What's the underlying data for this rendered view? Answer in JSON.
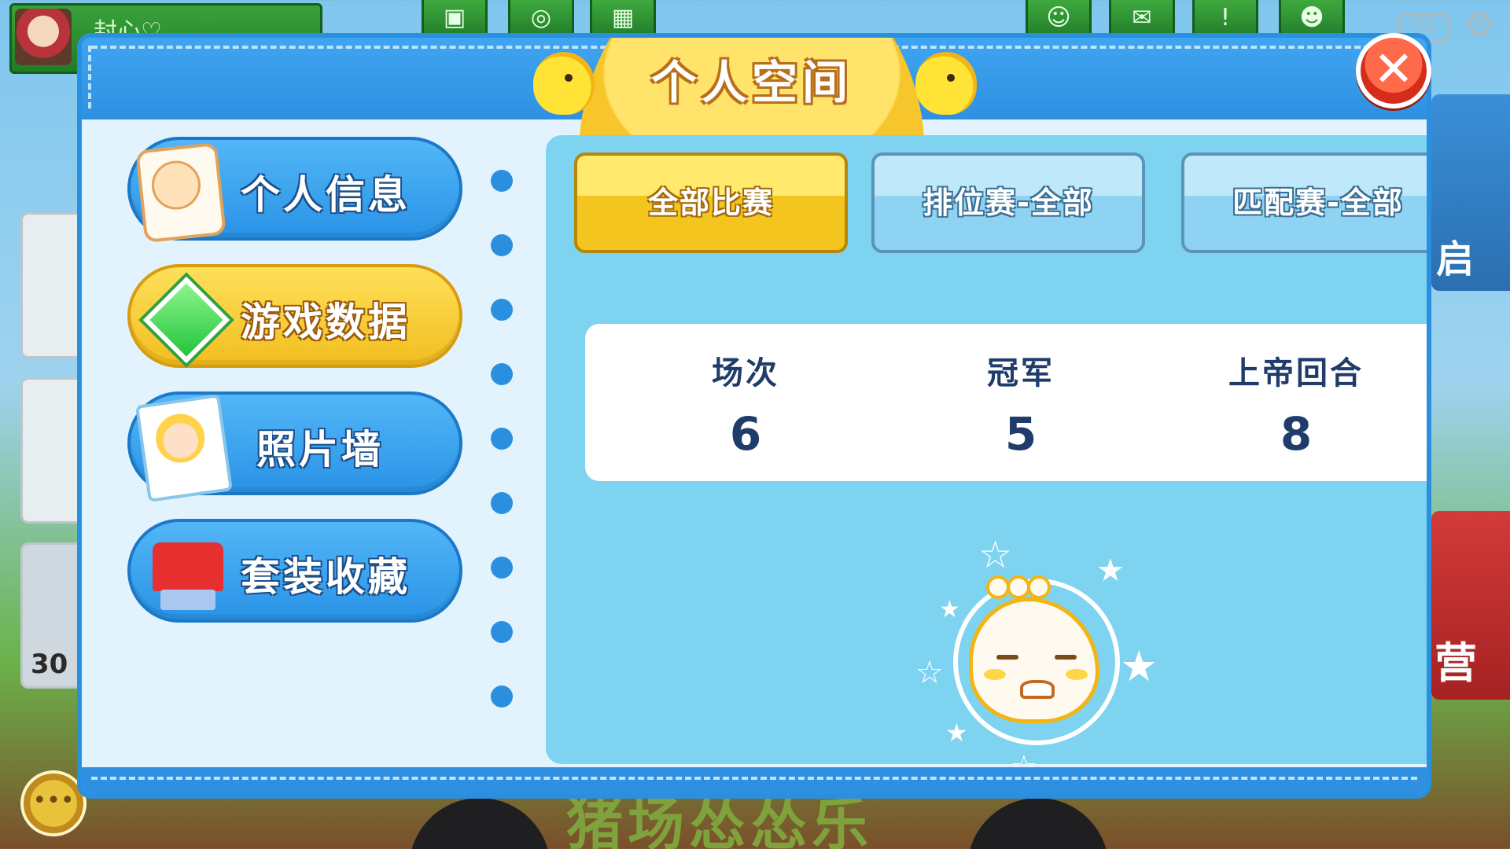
{
  "top_bar": {
    "player_name": "封心♡",
    "battery": "74",
    "icons": [
      "calendar-icon",
      "compass-icon",
      "gift-icon",
      "friend-icon",
      "mail-icon",
      "notice-icon",
      "group-icon"
    ]
  },
  "background": {
    "ground_title": "猪场怂怂乐",
    "left_card_text": "30",
    "right_card_text_1": "启",
    "right_card_text_2": "营"
  },
  "dialog": {
    "title": "个人空间",
    "close_label": "✕"
  },
  "sidebar": {
    "items": [
      {
        "label": "个人信息",
        "icon": "profile-card-icon",
        "active": false
      },
      {
        "label": "游戏数据",
        "icon": "diamond-icon",
        "active": true
      },
      {
        "label": "照片墙",
        "icon": "photo-icon",
        "active": false
      },
      {
        "label": "套装收藏",
        "icon": "outfit-icon",
        "active": false
      }
    ]
  },
  "filters": {
    "tabs": [
      {
        "label": "全部比赛",
        "active": true
      },
      {
        "label": "排位赛-全部",
        "active": false
      },
      {
        "label": "匹配赛-全部",
        "active": false
      }
    ]
  },
  "stats": [
    {
      "label": "场次",
      "value": "6"
    },
    {
      "label": "冠军",
      "value": "5"
    },
    {
      "label": "上帝回合",
      "value": "8"
    }
  ],
  "colors": {
    "accent_blue": "#2b8fe0",
    "accent_yellow": "#f4c51e",
    "panel": "#7dd3f0",
    "stat_text": "#1f3c6b"
  }
}
